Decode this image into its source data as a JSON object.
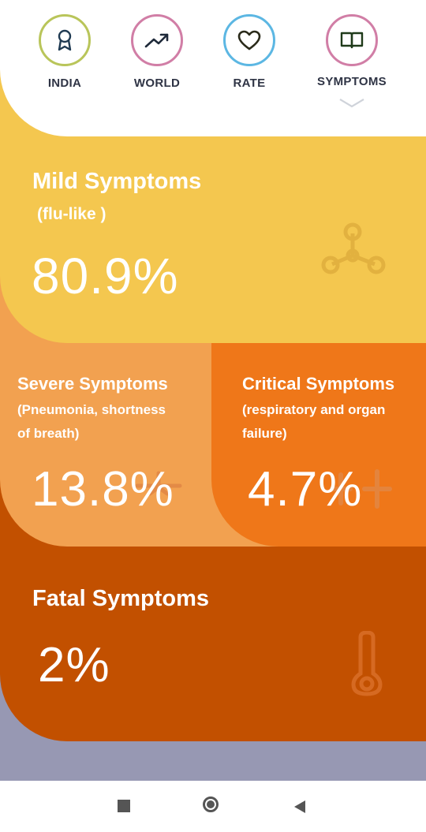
{
  "nav": {
    "items": [
      {
        "label": "INDIA",
        "icon": "award-icon",
        "color": "#b9c55a"
      },
      {
        "label": "WORLD",
        "icon": "trending-up-icon",
        "color": "#d17ea6"
      },
      {
        "label": "RATE",
        "icon": "heart-icon",
        "color": "#5cb7e3"
      },
      {
        "label": "SYMPTOMS",
        "icon": "book-icon",
        "color": "#d17ea6"
      }
    ]
  },
  "mild": {
    "title": "Mild Symptoms",
    "subtitle": "(flu-like )",
    "value": "80.9%",
    "color": "#f4c74f"
  },
  "severe": {
    "title": "Severe Symptoms",
    "subtitle_line1": "(Pneumonia, shortness",
    "subtitle_line2": "of breath)",
    "value": "13.8%",
    "color": "#f2a150"
  },
  "critical": {
    "title": "Critical Symptoms",
    "subtitle_line1": "(respiratory and organ",
    "subtitle_line2": "failure)",
    "value": "4.7%",
    "color": "#ef7719"
  },
  "fatal": {
    "title": "Fatal Symptoms",
    "value": "2%",
    "color": "#c25000"
  },
  "system_nav": {
    "icons": [
      "recents-square-icon",
      "home-circle-icon",
      "back-triangle-icon"
    ]
  }
}
